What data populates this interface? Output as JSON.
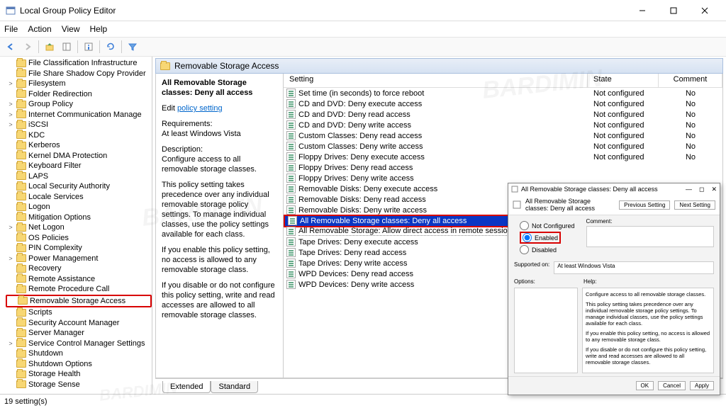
{
  "window": {
    "title": "Local Group Policy Editor"
  },
  "menu": {
    "file": "File",
    "action": "Action",
    "view": "View",
    "help": "Help"
  },
  "tree": {
    "items": [
      {
        "label": "File Classification Infrastructure",
        "twisty": ""
      },
      {
        "label": "File Share Shadow Copy Provider",
        "twisty": ""
      },
      {
        "label": "Filesystem",
        "twisty": ">"
      },
      {
        "label": "Folder Redirection",
        "twisty": ""
      },
      {
        "label": "Group Policy",
        "twisty": ">"
      },
      {
        "label": "Internet Communication Manage",
        "twisty": ">"
      },
      {
        "label": "iSCSI",
        "twisty": ">"
      },
      {
        "label": "KDC",
        "twisty": ""
      },
      {
        "label": "Kerberos",
        "twisty": ""
      },
      {
        "label": "Kernel DMA Protection",
        "twisty": ""
      },
      {
        "label": "Keyboard Filter",
        "twisty": ""
      },
      {
        "label": "LAPS",
        "twisty": ""
      },
      {
        "label": "Local Security Authority",
        "twisty": ""
      },
      {
        "label": "Locale Services",
        "twisty": ""
      },
      {
        "label": "Logon",
        "twisty": ""
      },
      {
        "label": "Mitigation Options",
        "twisty": ""
      },
      {
        "label": "Net Logon",
        "twisty": ">"
      },
      {
        "label": "OS Policies",
        "twisty": ""
      },
      {
        "label": "PIN Complexity",
        "twisty": ""
      },
      {
        "label": "Power Management",
        "twisty": ">"
      },
      {
        "label": "Recovery",
        "twisty": ""
      },
      {
        "label": "Remote Assistance",
        "twisty": ""
      },
      {
        "label": "Remote Procedure Call",
        "twisty": ""
      },
      {
        "label": "Removable Storage Access",
        "twisty": "",
        "selected": true
      },
      {
        "label": "Scripts",
        "twisty": ""
      },
      {
        "label": "Security Account Manager",
        "twisty": ""
      },
      {
        "label": "Server Manager",
        "twisty": ""
      },
      {
        "label": "Service Control Manager Settings",
        "twisty": ">"
      },
      {
        "label": "Shutdown",
        "twisty": ""
      },
      {
        "label": "Shutdown Options",
        "twisty": ""
      },
      {
        "label": "Storage Health",
        "twisty": ""
      },
      {
        "label": "Storage Sense",
        "twisty": ""
      }
    ]
  },
  "header": {
    "title": "Removable Storage Access"
  },
  "desc": {
    "title": "All Removable Storage classes: Deny all access",
    "edit_prefix": "Edit ",
    "edit_link": "policy setting",
    "req_label": "Requirements:",
    "req_value": "At least Windows Vista",
    "desc_label": "Description:",
    "desc_p1": "Configure access to all removable storage classes.",
    "desc_p2": "This policy setting takes precedence over any individual removable storage policy settings. To manage individual classes, use the policy settings available for each class.",
    "desc_p3": "If you enable this policy setting, no access is allowed to any removable storage class.",
    "desc_p4": "If you disable or do not configure this policy setting, write and read accesses are allowed to all removable storage classes."
  },
  "list": {
    "cols": {
      "setting": "Setting",
      "state": "State",
      "comment": "Comment"
    },
    "rows": [
      {
        "setting": "Set time (in seconds) to force reboot",
        "state": "Not configured",
        "comment": "No"
      },
      {
        "setting": "CD and DVD: Deny execute access",
        "state": "Not configured",
        "comment": "No"
      },
      {
        "setting": "CD and DVD: Deny read access",
        "state": "Not configured",
        "comment": "No"
      },
      {
        "setting": "CD and DVD: Deny write access",
        "state": "Not configured",
        "comment": "No"
      },
      {
        "setting": "Custom Classes: Deny read access",
        "state": "Not configured",
        "comment": "No"
      },
      {
        "setting": "Custom Classes: Deny write access",
        "state": "Not configured",
        "comment": "No"
      },
      {
        "setting": "Floppy Drives: Deny execute access",
        "state": "Not configured",
        "comment": "No"
      },
      {
        "setting": "Floppy Drives: Deny read access",
        "state": "",
        "comment": ""
      },
      {
        "setting": "Floppy Drives: Deny write access",
        "state": "",
        "comment": ""
      },
      {
        "setting": "Removable Disks: Deny execute access",
        "state": "",
        "comment": ""
      },
      {
        "setting": "Removable Disks: Deny read access",
        "state": "",
        "comment": ""
      },
      {
        "setting": "Removable Disks: Deny write access",
        "state": "",
        "comment": ""
      },
      {
        "setting": "All Removable Storage classes: Deny all access",
        "state": "",
        "comment": "",
        "hl": true
      },
      {
        "setting": "All Removable Storage: Allow direct access in remote sessions",
        "state": "",
        "comment": "",
        "after": true
      },
      {
        "setting": "Tape Drives: Deny execute access",
        "state": "",
        "comment": ""
      },
      {
        "setting": "Tape Drives: Deny read access",
        "state": "",
        "comment": ""
      },
      {
        "setting": "Tape Drives: Deny write access",
        "state": "",
        "comment": ""
      },
      {
        "setting": "WPD Devices: Deny read access",
        "state": "",
        "comment": ""
      },
      {
        "setting": "WPD Devices: Deny write access",
        "state": "",
        "comment": ""
      }
    ]
  },
  "tabs": {
    "extended": "Extended",
    "standard": "Standard"
  },
  "status": {
    "text": "19 setting(s)"
  },
  "dialog": {
    "title": "All Removable Storage classes: Deny all access",
    "header_title": "All Removable Storage classes: Deny all access",
    "prev": "Previous Setting",
    "next": "Next Setting",
    "comment_label": "Comment:",
    "r_notconf": "Not Configured",
    "r_enabled": "Enabled",
    "r_disabled": "Disabled",
    "supported_label": "Supported on:",
    "supported_value": "At least Windows Vista",
    "options_label": "Options:",
    "help_label": "Help:",
    "help_p1": "Configure access to all removable storage classes.",
    "help_p2": "This policy setting takes precedence over any individual removable storage policy settings. To manage individual classes, use the policy settings available for each class.",
    "help_p3": "If you enable this policy setting, no access is allowed to any removable storage class.",
    "help_p4": "If you disable or do not configure this policy setting, write and read accesses are allowed to all removable storage classes.",
    "ok": "OK",
    "cancel": "Cancel",
    "apply": "Apply"
  },
  "watermark": "BARDIMIN"
}
